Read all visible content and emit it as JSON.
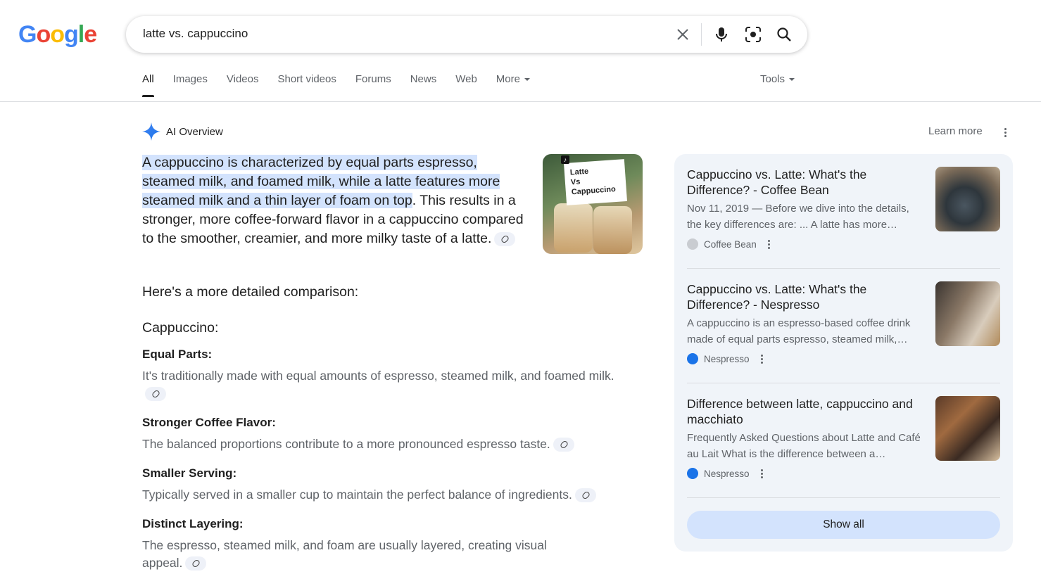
{
  "logo": {
    "letters": [
      "G",
      "o",
      "o",
      "g",
      "l",
      "e"
    ],
    "colors": [
      "#4285f4",
      "#ea4335",
      "#fbbc05",
      "#4285f4",
      "#34a853",
      "#ea4335"
    ]
  },
  "search": {
    "query": "latte vs. cappuccino"
  },
  "tabs": [
    {
      "label": "All",
      "active": true
    },
    {
      "label": "Images"
    },
    {
      "label": "Videos"
    },
    {
      "label": "Short videos"
    },
    {
      "label": "Forums"
    },
    {
      "label": "News"
    },
    {
      "label": "Web"
    },
    {
      "label": "More",
      "dropdown": true
    }
  ],
  "tools_label": "Tools",
  "ai_overview": {
    "label": "AI Overview",
    "learn_more": "Learn more",
    "lead_highlight": "A cappuccino is characterized by equal parts espresso, steamed milk, and foamed milk, while a latte features more steamed milk and a thin layer of foam on top",
    "lead_rest": ". This results in a stronger, more coffee-forward flavor in a cappuccino com­pared to the smoother, creamier, and more milky taste of a latte.",
    "thumbnail_text": [
      "Latte",
      "Vs",
      "Cappuccino"
    ],
    "detail_intro": "Here's a more detailed comparison:",
    "subheading": "Cappuccino:",
    "items": [
      {
        "title": "Equal Parts:",
        "desc": "It's traditionally made with equal amounts of espresso, steamed milk, and foamed milk."
      },
      {
        "title": "Stronger Coffee Flavor:",
        "desc": "The balanced proportions contribute to a more pronounced espresso taste."
      },
      {
        "title": "Smaller Serving:",
        "desc": "Typically served in a smaller cup to maintain the perfect balance of ingredients."
      },
      {
        "title": "Distinct Layering:",
        "desc": "The espresso, steamed milk, and foam are usually layered, creating visual appeal."
      }
    ]
  },
  "sources": [
    {
      "title": "Cappuccino vs. Latte: What's the Difference? - Coffee Bean",
      "snippet": "Nov 11, 2019 — Before we dive into the details, the key differences are: ... A latte has more…",
      "site": "Coffee Bean"
    },
    {
      "title": "Cappuccino vs. Latte: What's the Difference? - Nespresso",
      "snippet": "A cappuccino is an espresso-based coffee drink made of equal parts espresso, steamed milk,…",
      "site": "Nespresso"
    },
    {
      "title": "Difference between latte, cappuccino and macchiato",
      "snippet": "Frequently Asked Questions about Latte and Café au Lait What is the difference between a…",
      "site": "Nespresso"
    }
  ],
  "show_all": "Show all"
}
